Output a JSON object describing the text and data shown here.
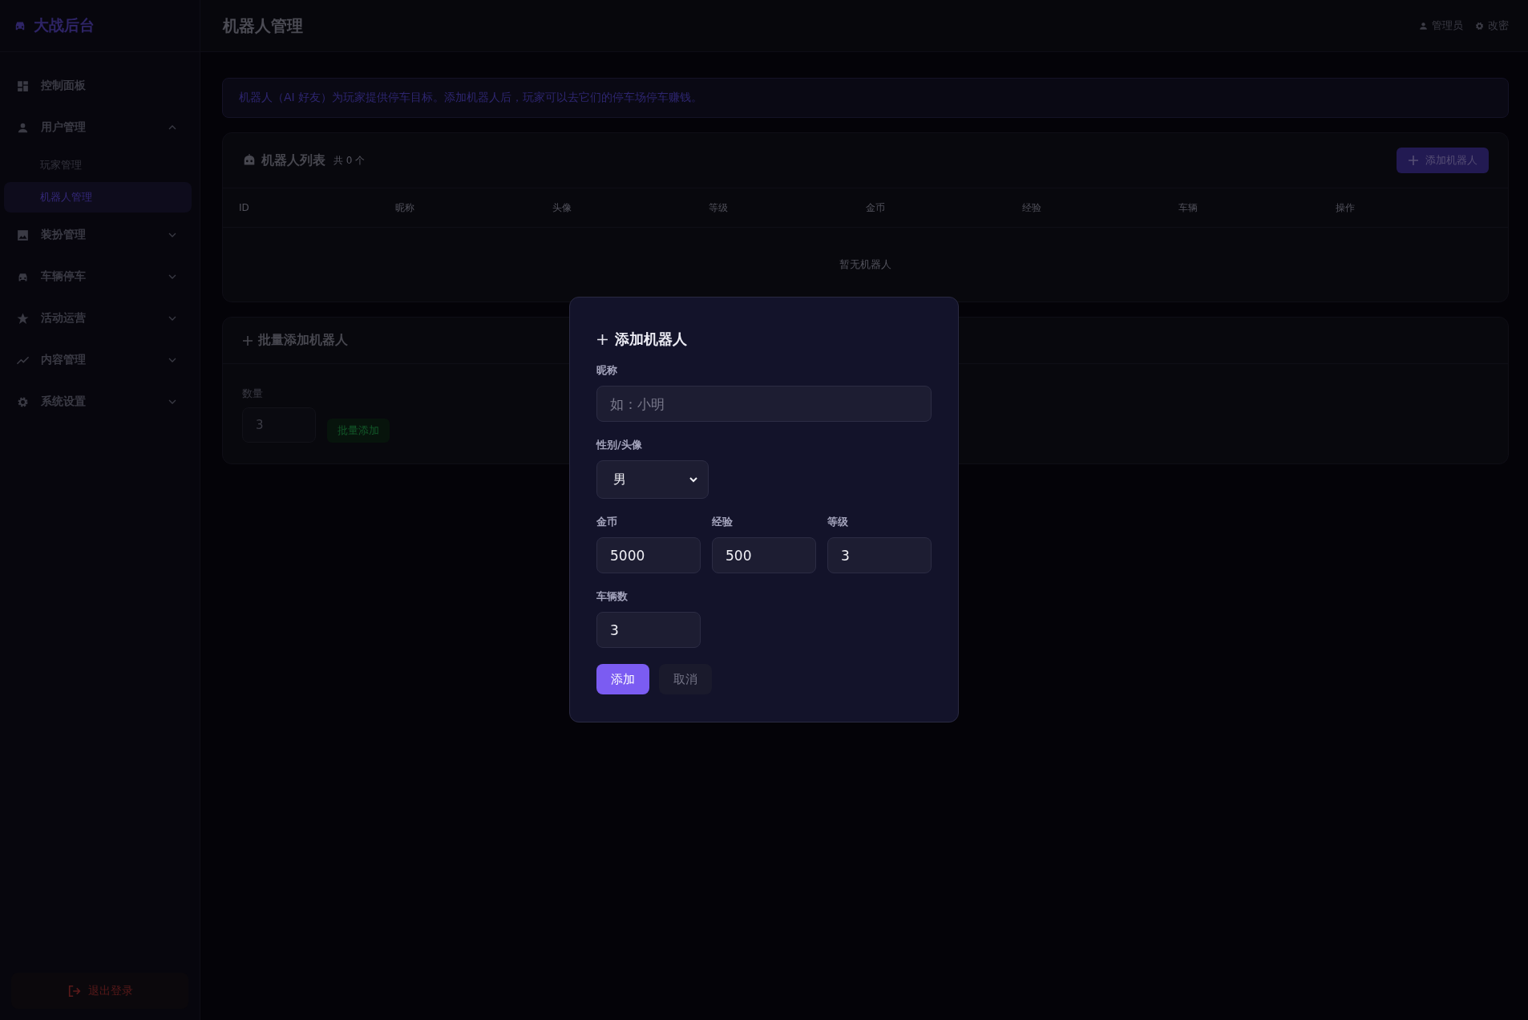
{
  "sidebar": {
    "logo": "大战后台",
    "items": [
      {
        "label": "控制面板"
      },
      {
        "label": "用户管理",
        "expanded": true,
        "children": [
          {
            "label": "玩家管理",
            "selected": false
          },
          {
            "label": "机器人管理",
            "selected": true
          }
        ]
      },
      {
        "label": "装扮管理",
        "expanded": false
      },
      {
        "label": "车辆停车",
        "expanded": false
      },
      {
        "label": "活动运营",
        "expanded": false
      },
      {
        "label": "内容管理",
        "expanded": false
      },
      {
        "label": "系统设置",
        "expanded": false
      }
    ],
    "logout": "退出登录"
  },
  "header": {
    "title": "机器人管理",
    "user": "管理员",
    "change_password": "改密"
  },
  "notice": "机器人（AI 好友）为玩家提供停车目标。添加机器人后，玩家可以去它们的停车场停车赚钱。",
  "robot_list": {
    "title": "机器人列表",
    "count": "共 0 个",
    "add_button": "添加机器人",
    "columns": [
      "ID",
      "昵称",
      "头像",
      "等级",
      "金币",
      "经验",
      "车辆",
      "操作"
    ],
    "empty": "暂无机器人"
  },
  "batch": {
    "title": "批量添加机器人",
    "quantity_label": "数量",
    "quantity": "3",
    "button": "批量添加"
  },
  "dialog": {
    "title": "添加机器人",
    "rows": [
      [
        {
          "label": "昵称",
          "kind": "text",
          "placeholder": "如：小明"
        }
      ],
      [
        {
          "label": "性别/头像",
          "kind": "select",
          "value": "男"
        }
      ],
      [
        {
          "label": "金币",
          "kind": "number",
          "value": "5000"
        },
        {
          "label": "经验",
          "kind": "number",
          "value": "500"
        },
        {
          "label": "等级",
          "kind": "number",
          "value": "3"
        }
      ],
      [
        {
          "label": "车辆数",
          "kind": "number",
          "value": "3"
        }
      ]
    ],
    "buttons": [
      {
        "label": "添加",
        "kind": "primary"
      },
      {
        "label": "取消",
        "kind": "secondary"
      }
    ]
  }
}
